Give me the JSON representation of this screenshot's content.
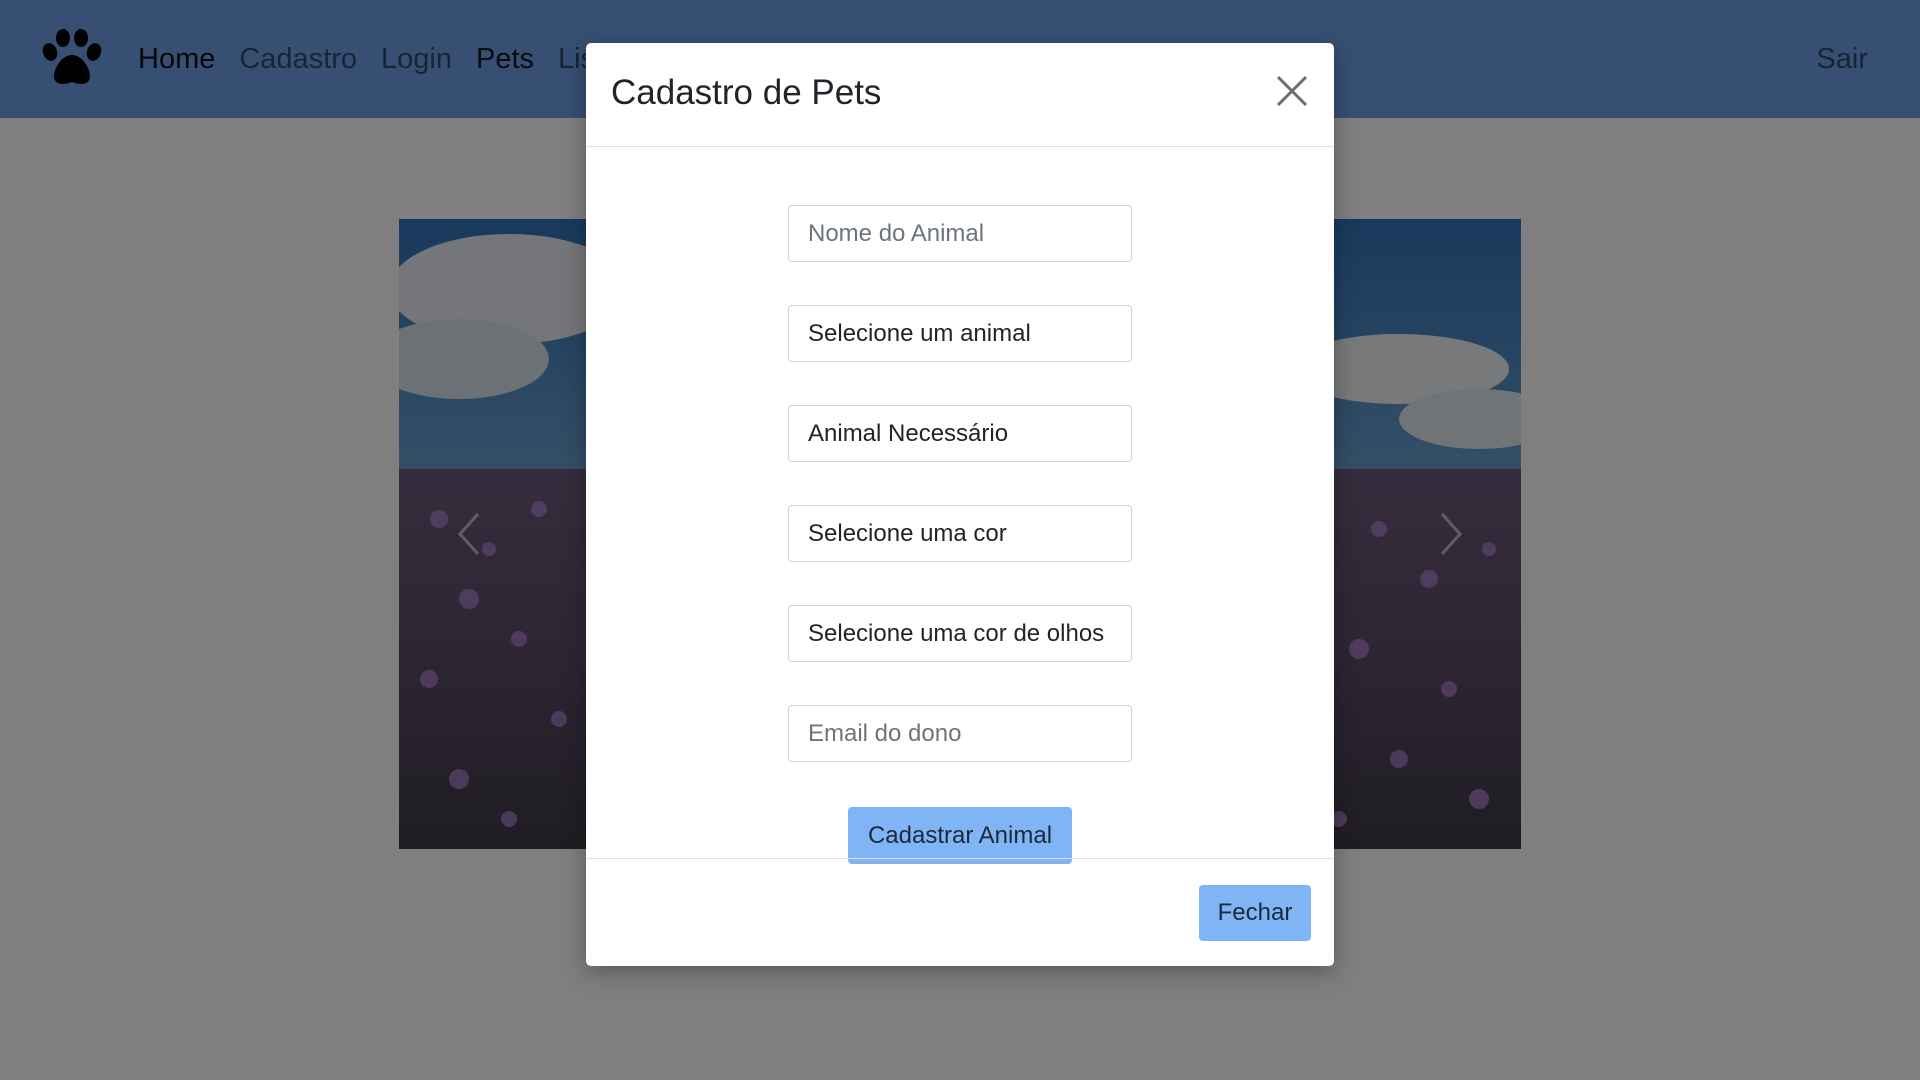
{
  "navbar": {
    "logo_icon": "paw-icon",
    "links": [
      {
        "label": "Home",
        "active": true
      },
      {
        "label": "Cadastro",
        "active": false
      },
      {
        "label": "Login",
        "active": false
      },
      {
        "label": "Pets",
        "active": false
      },
      {
        "label": "Lis",
        "active": false
      }
    ],
    "right_link": "Sair"
  },
  "carousel": {
    "prev_icon": "chevron-left-icon",
    "next_icon": "chevron-right-icon"
  },
  "modal": {
    "title": "Cadastro de Pets",
    "close_icon": "close-icon",
    "form": {
      "name_placeholder": "Nome do Animal",
      "animal_select": "Selecione um animal",
      "animal_required": "Animal Necessário",
      "color_select": "Selecione uma cor",
      "eye_color_select": "Selecione uma cor de olhos",
      "email_placeholder": "Email do dono",
      "submit_label": "Cadastrar Animal"
    },
    "footer": {
      "close_label": "Fechar"
    }
  },
  "colors": {
    "navbar": "#6f9fe6",
    "primary_button": "#7fb5f5",
    "backdrop": "rgba(0,0,0,0.5)"
  }
}
